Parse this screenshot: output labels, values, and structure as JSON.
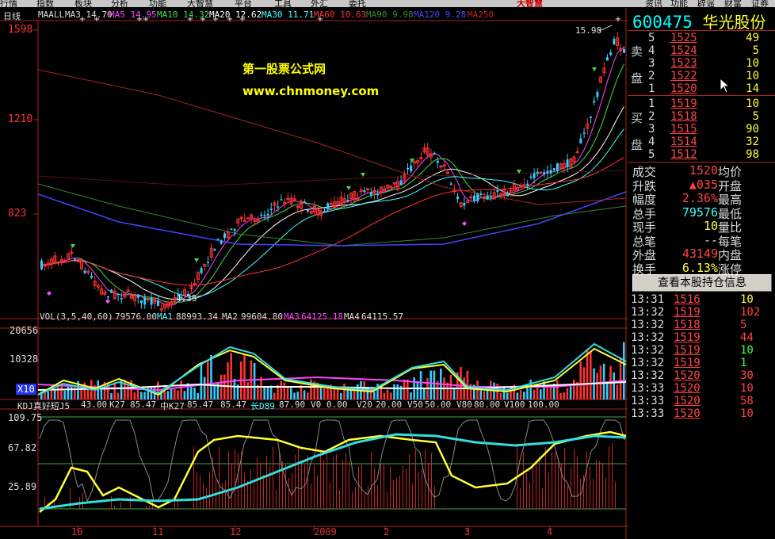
{
  "menu": [
    "行情",
    "指数",
    "板块",
    "分析",
    "功能",
    "大智慧",
    "平台",
    "工具",
    "外汇",
    "委托"
  ],
  "logo_text": "大智慧",
  "top_buttons": [
    "资讯",
    "功能",
    "辟谣",
    "财富",
    "证券"
  ],
  "chart_header": {
    "period": "日线",
    "ma_items": [
      {
        "label": "MAALL",
        "value": "",
        "color": "#dddddd"
      },
      {
        "label": "MA3",
        "value": "14.70",
        "color": "#dddddd"
      },
      {
        "label": "MA5",
        "value": "14.95",
        "color": "#ff44ff"
      },
      {
        "label": "MA10",
        "value": "14.32",
        "color": "#44dd44"
      },
      {
        "label": "MA20",
        "value": "12.62",
        "color": "#ffffff"
      },
      {
        "label": "MA30",
        "value": "11.71",
        "color": "#44ffff"
      },
      {
        "label": "MA60",
        "value": "10.63",
        "color": "#ff3333"
      },
      {
        "label": "MA90",
        "value": "9.98",
        "color": "#338833"
      },
      {
        "label": "MA120",
        "value": "9.28",
        "color": "#4444ff"
      },
      {
        "label": "MA250",
        "value": "",
        "color": "#bb2222"
      }
    ]
  },
  "price_axis": [
    "1598",
    "1210",
    "823"
  ],
  "price_annotations": {
    "high": "15.98",
    "low": "4.35"
  },
  "watermark": {
    "line1": "第一股票公式网",
    "line2": "www.chnmoney.com"
  },
  "volume": {
    "header": [
      {
        "text": "VOL(3,5,40,60)",
        "color": "#dddddd"
      },
      {
        "text": "79576.00",
        "color": "#dddddd"
      },
      {
        "text": "MA1",
        "color": "#44ffff"
      },
      {
        "text": "88993.34",
        "color": "#dddddd"
      },
      {
        "text": "MA2",
        "color": "#dddddd"
      },
      {
        "text": "99604.80",
        "color": "#dddddd"
      },
      {
        "text": "MA3",
        "color": "#ff44ff"
      },
      {
        "text": "64125.18",
        "color": "#ff44ff"
      },
      {
        "text": "MA4",
        "color": "#dddddd"
      },
      {
        "text": "64115.57",
        "color": "#dddddd"
      }
    ],
    "axis": [
      "20656",
      "10328",
      "X10"
    ]
  },
  "kdj": {
    "header": [
      {
        "text": "KDJ真好短J5",
        "color": "#dddddd"
      },
      {
        "text": "43.00",
        "color": "#dddddd"
      },
      {
        "text": "K27",
        "color": "#dddddd"
      },
      {
        "text": "85.47",
        "color": "#dddddd"
      },
      {
        "text": "中K27",
        "color": "#dddddd"
      },
      {
        "text": "85.47",
        "color": "#dddddd"
      },
      {
        "text": "85.47",
        "color": "#dddddd"
      },
      {
        "text": "长D89",
        "color": "#44ffff"
      },
      {
        "text": "87.90",
        "color": "#dddddd"
      },
      {
        "text": "V0",
        "color": "#dddddd"
      },
      {
        "text": "0.00",
        "color": "#dddddd"
      },
      {
        "text": "V20",
        "color": "#dddddd"
      },
      {
        "text": "20.00",
        "color": "#dddddd"
      },
      {
        "text": "V50",
        "color": "#dddddd"
      },
      {
        "text": "50.00",
        "color": "#dddddd"
      },
      {
        "text": "V80",
        "color": "#dddddd"
      },
      {
        "text": "80.00",
        "color": "#dddddd"
      },
      {
        "text": "V100",
        "color": "#dddddd"
      },
      {
        "text": "100.00",
        "color": "#dddddd"
      }
    ],
    "axis": [
      "109.75",
      "67.82",
      "25.89"
    ]
  },
  "x_axis": [
    "10",
    "11",
    "12",
    "2009",
    "2",
    "3",
    "4"
  ],
  "quote": {
    "code": "600475",
    "name": "华光股份",
    "sell_label": [
      "卖",
      "盘"
    ],
    "buy_label": [
      "买",
      "盘"
    ],
    "sell": [
      {
        "lv": "5",
        "price": "1525",
        "vol": "49"
      },
      {
        "lv": "4",
        "price": "1524",
        "vol": "5"
      },
      {
        "lv": "3",
        "price": "1523",
        "vol": "10"
      },
      {
        "lv": "2",
        "price": "1522",
        "vol": "10"
      },
      {
        "lv": "1",
        "price": "1520",
        "vol": "14"
      }
    ],
    "buy": [
      {
        "lv": "1",
        "price": "1519",
        "vol": "10"
      },
      {
        "lv": "2",
        "price": "1518",
        "vol": "5"
      },
      {
        "lv": "3",
        "price": "1515",
        "vol": "90"
      },
      {
        "lv": "4",
        "price": "1514",
        "vol": "32"
      },
      {
        "lv": "5",
        "price": "1512",
        "vol": "98"
      }
    ],
    "stats": [
      {
        "k1": "成交",
        "v1": "1520",
        "c1": "#ff4444",
        "k2": "均价"
      },
      {
        "k1": "升跌",
        "v1": "▲035",
        "c1": "#ff4444",
        "k2": "开盘"
      },
      {
        "k1": "幅度",
        "v1": "2.36%",
        "c1": "#ff4444",
        "k2": "最高"
      },
      {
        "k1": "总手",
        "v1": "79576",
        "c1": "#44ffff",
        "k2": "最低"
      },
      {
        "k1": "现手",
        "v1": "10",
        "c1": "#ffff44",
        "k2": "量比"
      },
      {
        "k1": "总笔",
        "v1": "--",
        "c1": "#dddddd",
        "k2": "每笔"
      },
      {
        "k1": "外盘",
        "v1": "43149",
        "c1": "#ff4444",
        "k2": "内盘"
      },
      {
        "k1": "换手",
        "v1": "6.13%",
        "c1": "#ffff44",
        "k2": "涨停"
      }
    ],
    "button": "查看本股持仓信息",
    "ticks": [
      {
        "t": "13:31",
        "p": "1516",
        "v": "10",
        "vc": "#ffff44"
      },
      {
        "t": "13:32",
        "p": "1519",
        "v": "102",
        "vc": "#ff4444"
      },
      {
        "t": "13:32",
        "p": "1518",
        "v": "5",
        "vc": "#ff4444"
      },
      {
        "t": "13:32",
        "p": "1519",
        "v": "44",
        "vc": "#ff4444"
      },
      {
        "t": "13:32",
        "p": "1519",
        "v": "10",
        "vc": "#44ff44"
      },
      {
        "t": "13:32",
        "p": "1519",
        "v": "1",
        "vc": "#44ff44"
      },
      {
        "t": "13:32",
        "p": "1520",
        "v": "30",
        "vc": "#ff4444"
      },
      {
        "t": "13:33",
        "p": "1520",
        "v": "10",
        "vc": "#ff4444"
      },
      {
        "t": "13:33",
        "p": "1520",
        "v": "58",
        "vc": "#ff4444"
      },
      {
        "t": "13:33",
        "p": "1520",
        "v": "10",
        "vc": "#ff4444"
      }
    ]
  },
  "colors": {
    "up": "#ff3333",
    "down": "#33ccff",
    "kdj_yellow": "#ffff33",
    "kdj_cyan": "#33dddd",
    "border": "#aa2222"
  }
}
